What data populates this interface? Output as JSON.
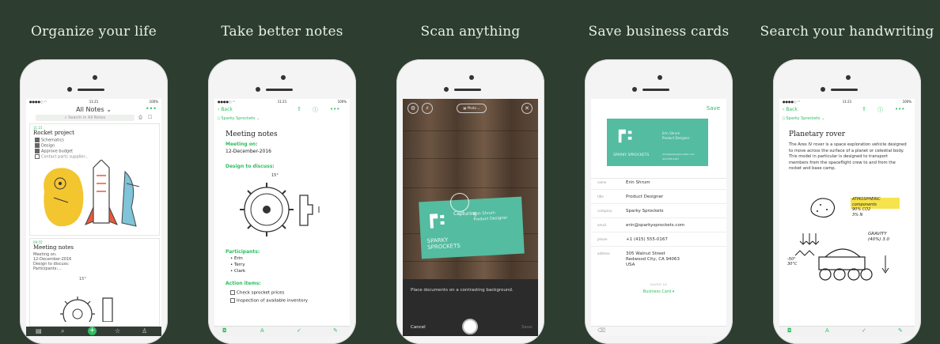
{
  "captions": [
    "Organize your life",
    "Take better notes",
    "Scan anything",
    "Save business cards",
    "Search your handwriting"
  ],
  "status": {
    "time": "11:21",
    "battery": "100%"
  },
  "colors": {
    "background": "#2d3d30",
    "accent": "#2dbe60",
    "card": "#54bca0"
  },
  "p1": {
    "title": "All Notes",
    "search_placeholder": "Search in All Notes",
    "note1": {
      "time": "11:21",
      "title": "Rocket project",
      "items": [
        {
          "label": "Schematics",
          "checked": true
        },
        {
          "label": "Design",
          "checked": true
        },
        {
          "label": "Approve budget",
          "checked": true
        },
        {
          "label": "Contact parts supplier...",
          "checked": false
        }
      ]
    },
    "note2": {
      "time": "09:55",
      "title": "Meeting notes",
      "lines": [
        "Meeting on:",
        "12-December-2016",
        "Design to discuss:",
        "Participants:..."
      ],
      "sketch_label": "15°"
    },
    "tabs": [
      "note-icon",
      "search-icon",
      "add-icon",
      "star-icon",
      "account-icon"
    ]
  },
  "p2": {
    "back": "Back",
    "notebook": "Sparky Sprockets",
    "title": "Meeting notes",
    "meeting_label": "Meeting on:",
    "meeting_date": "12-December-2016",
    "design_label": "Design to discuss:",
    "sketch_label": "15°",
    "participants_label": "Participants:",
    "participants": [
      "Erin",
      "Terry",
      "Clark"
    ],
    "actions_label": "Action items:",
    "actions": [
      "Check sprocket prices",
      "Inspection of available inventory"
    ]
  },
  "p3": {
    "mode": "Photo",
    "capturing": "Capturing",
    "card_name": "Erin Shrum",
    "card_title": "Product Designer",
    "card_company": "SPARKY\nSPROCKETS",
    "hint": "Place documents on a contrasting background.",
    "cancel": "Cancel",
    "save": "Save"
  },
  "p4": {
    "save": "Save",
    "card_name": "Erin Shrum",
    "card_title": "Product Designer",
    "card_company": "SPARKY SPROCKETS",
    "card_email": "erin@sparkysprockets.com",
    "card_phone": "415.555.0167",
    "fields": [
      {
        "label": "name",
        "value": "Erin Shrum"
      },
      {
        "label": "title",
        "value": "Product Designer"
      },
      {
        "label": "company",
        "value": "Sparky Sprockets"
      },
      {
        "label": "email",
        "value": "erin@sparkysprockets.com"
      },
      {
        "label": "phone",
        "value": "+1 (415) 555-0167"
      },
      {
        "label": "address",
        "value": "305 Walnut Street\nRedwood City, CA 94063\nUSA"
      }
    ],
    "saved_as": "SAVED AS",
    "save_type": "Business Card"
  },
  "p5": {
    "back": "Back",
    "notebook": "Sparky Sprockets",
    "title": "Planetary rover",
    "body": "The Ares IV rover is a space exploration vehicle designed to move across the surface of a planet or celestial body. This model in particular is designed to transport members from the spaceflight crew to and from the rocket and base camp.",
    "hw1": "ATMOSPHERIC\ncomponents\n90% CO2\n3% N",
    "hw2": "GRAVITY\n(40%) 3.0",
    "hw3": "-50°\n30°C"
  }
}
